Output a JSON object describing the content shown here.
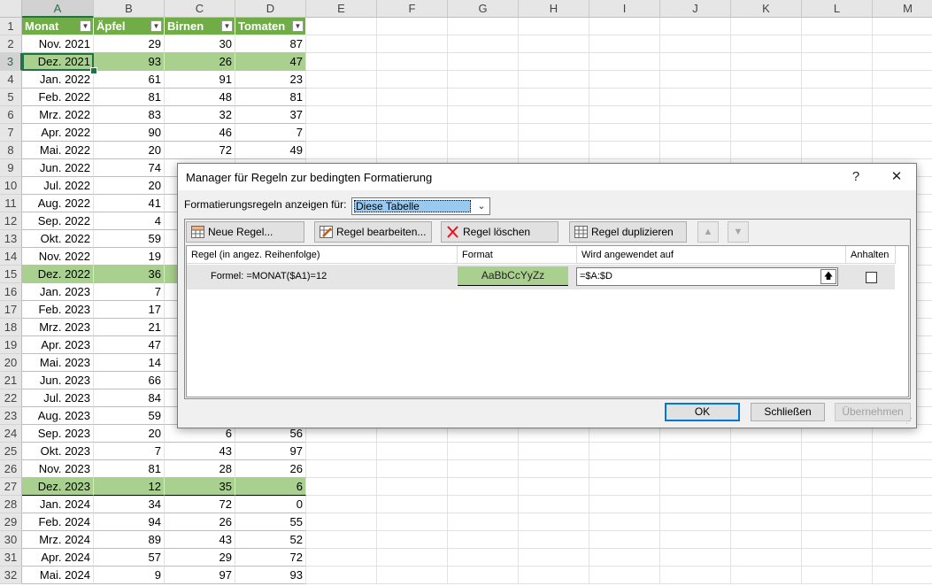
{
  "spreadsheet": {
    "columns": [
      "A",
      "B",
      "C",
      "D",
      "E",
      "F",
      "G",
      "H",
      "I",
      "J",
      "K",
      "L",
      "M"
    ],
    "headers": [
      "Monat",
      "Äpfel",
      "Birnen",
      "Tomaten"
    ],
    "rows": [
      [
        "Nov. 2021",
        "29",
        "30",
        "87"
      ],
      [
        "Dez. 2021",
        "93",
        "26",
        "47"
      ],
      [
        "Jan. 2022",
        "61",
        "91",
        "23"
      ],
      [
        "Feb. 2022",
        "81",
        "48",
        "81"
      ],
      [
        "Mrz. 2022",
        "83",
        "32",
        "37"
      ],
      [
        "Apr. 2022",
        "90",
        "46",
        "7"
      ],
      [
        "Mai. 2022",
        "20",
        "72",
        "49"
      ],
      [
        "Jun. 2022",
        "74",
        "",
        ""
      ],
      [
        "Jul. 2022",
        "20",
        "",
        ""
      ],
      [
        "Aug. 2022",
        "41",
        "",
        ""
      ],
      [
        "Sep. 2022",
        "4",
        "",
        ""
      ],
      [
        "Okt. 2022",
        "59",
        "",
        ""
      ],
      [
        "Nov. 2022",
        "19",
        "",
        ""
      ],
      [
        "Dez. 2022",
        "36",
        "",
        ""
      ],
      [
        "Jan. 2023",
        "7",
        "",
        ""
      ],
      [
        "Feb. 2023",
        "17",
        "",
        ""
      ],
      [
        "Mrz. 2023",
        "21",
        "",
        ""
      ],
      [
        "Apr. 2023",
        "47",
        "",
        ""
      ],
      [
        "Mai. 2023",
        "14",
        "",
        ""
      ],
      [
        "Jun. 2023",
        "66",
        "",
        ""
      ],
      [
        "Jul. 2023",
        "84",
        "",
        ""
      ],
      [
        "Aug. 2023",
        "59",
        "",
        ""
      ],
      [
        "Sep. 2023",
        "20",
        "6",
        "56"
      ],
      [
        "Okt. 2023",
        "7",
        "43",
        "97"
      ],
      [
        "Nov. 2023",
        "81",
        "28",
        "26"
      ],
      [
        "Dez. 2023",
        "12",
        "35",
        "6"
      ],
      [
        "Jan. 2024",
        "34",
        "72",
        "0"
      ],
      [
        "Feb. 2024",
        "94",
        "26",
        "55"
      ],
      [
        "Mrz. 2024",
        "89",
        "43",
        "52"
      ],
      [
        "Apr. 2024",
        "57",
        "29",
        "72"
      ],
      [
        "Mai. 2024",
        "9",
        "97",
        "93"
      ]
    ],
    "highlight_color": "#a9d08e",
    "header_color": "#70ad47"
  },
  "dialog": {
    "title": "Manager für Regeln zur bedingten Formatierung",
    "help": "?",
    "close": "✕",
    "show_rules_label": "Formatierungsregeln anzeigen für:",
    "show_rules_value": "Diese Tabelle",
    "toolbar": {
      "new_rule": "Neue Regel...",
      "edit_rule": "Regel bearbeiten...",
      "delete_rule": "Regel löschen",
      "duplicate_rule": "Regel duplizieren",
      "move_up": "▲",
      "move_down": "▼"
    },
    "list_headers": {
      "rule": "Regel (in angez. Reihenfolge)",
      "format": "Format",
      "applies_to": "Wird angewendet auf",
      "stop": "Anhalten"
    },
    "rules": [
      {
        "rule": "Formel: =MONAT($A1)=12",
        "format_preview": "AaBbCcYyZz",
        "applies_to": "=$A:$D",
        "stop": false
      }
    ],
    "buttons": {
      "ok": "OK",
      "close": "Schließen",
      "apply": "Übernehmen"
    }
  }
}
